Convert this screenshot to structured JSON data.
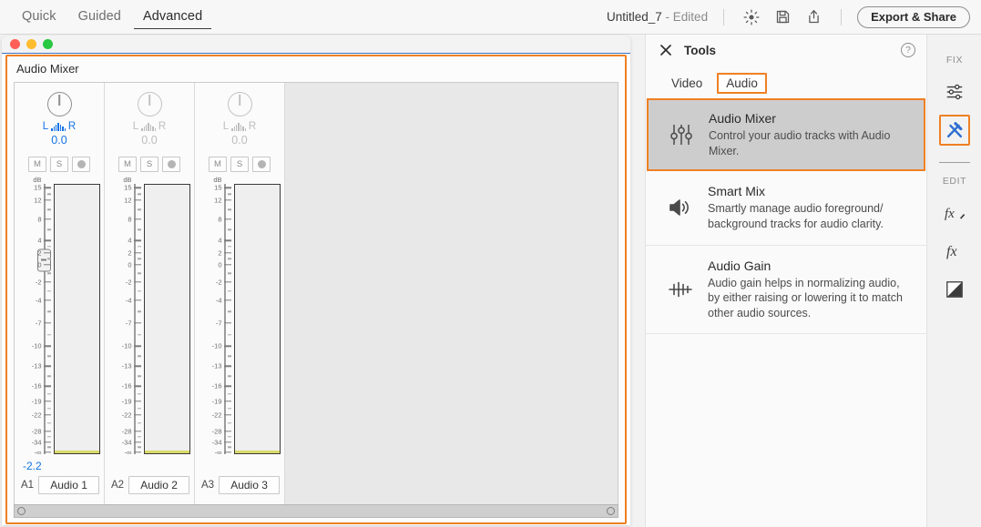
{
  "topbar": {
    "modes": [
      {
        "label": "Quick",
        "active": false
      },
      {
        "label": "Guided",
        "active": false
      },
      {
        "label": "Advanced",
        "active": true
      }
    ],
    "document_title": "Untitled_7",
    "document_state": "- Edited",
    "icons": [
      {
        "name": "brightness-icon",
        "glyph": "sun"
      },
      {
        "name": "save-icon",
        "glyph": "floppy"
      },
      {
        "name": "share-icon",
        "glyph": "upload"
      }
    ],
    "export_button": "Export & Share"
  },
  "mixer_window": {
    "title": "Audio Mixer",
    "window_controls": [
      "close",
      "minimize",
      "maximize"
    ],
    "border_color": "#ef8023",
    "db_unit_label": "dB",
    "db_scale": [
      "15",
      "12",
      "8",
      "4",
      "2",
      "0",
      "-2",
      "-4",
      "-7",
      "-10",
      "-13",
      "-16",
      "-19",
      "-22",
      "-28",
      "-34",
      "-∞"
    ],
    "tracks": [
      {
        "id": "A1",
        "name": "Audio 1",
        "pan_left": "L",
        "pan_right": "R",
        "pan_value": "0.0",
        "gain_value": "-2.2",
        "active": true,
        "mute": "M",
        "solo": "S",
        "record": "record-dot"
      },
      {
        "id": "A2",
        "name": "Audio 2",
        "pan_left": "L",
        "pan_right": "R",
        "pan_value": "0.0",
        "gain_value": "",
        "active": false,
        "mute": "M",
        "solo": "S",
        "record": "record-dot"
      },
      {
        "id": "A3",
        "name": "Audio 3",
        "pan_left": "L",
        "pan_right": "R",
        "pan_value": "0.0",
        "gain_value": "",
        "active": false,
        "mute": "M",
        "solo": "S",
        "record": "record-dot"
      }
    ]
  },
  "tools_panel": {
    "title": "Tools",
    "close_label": "close-icon",
    "help_label": "?",
    "tabs": [
      {
        "label": "Video",
        "selected": false
      },
      {
        "label": "Audio",
        "selected": true
      }
    ],
    "cards": [
      {
        "title": "Audio Mixer",
        "description": "Control your audio tracks with Audio Mixer.",
        "icon": "mixer-sliders-icon",
        "selected": true
      },
      {
        "title": "Smart Mix",
        "description": "Smartly manage audio foreground/ background tracks for audio clarity.",
        "icon": "speaker-icon",
        "selected": false
      },
      {
        "title": "Audio Gain",
        "description": "Audio gain helps in normalizing audio, by either raising or lowering it to match other audio sources.",
        "icon": "waveform-icon",
        "selected": false
      }
    ]
  },
  "right_rail": {
    "fix_label": "FIX",
    "edit_label": "EDIT",
    "fix_icons": [
      {
        "name": "adjust-sliders-icon",
        "selected": false
      },
      {
        "name": "tools-hammer-icon",
        "selected": true
      }
    ],
    "edit_icons": [
      {
        "name": "fx-transition-icon",
        "selected": false
      },
      {
        "name": "fx-effects-icon",
        "selected": false
      },
      {
        "name": "color-split-icon",
        "selected": false
      }
    ]
  },
  "colors": {
    "accent_orange": "#ef8023",
    "accent_blue": "#1473e6",
    "meter_yellow": "#d9d96a"
  }
}
